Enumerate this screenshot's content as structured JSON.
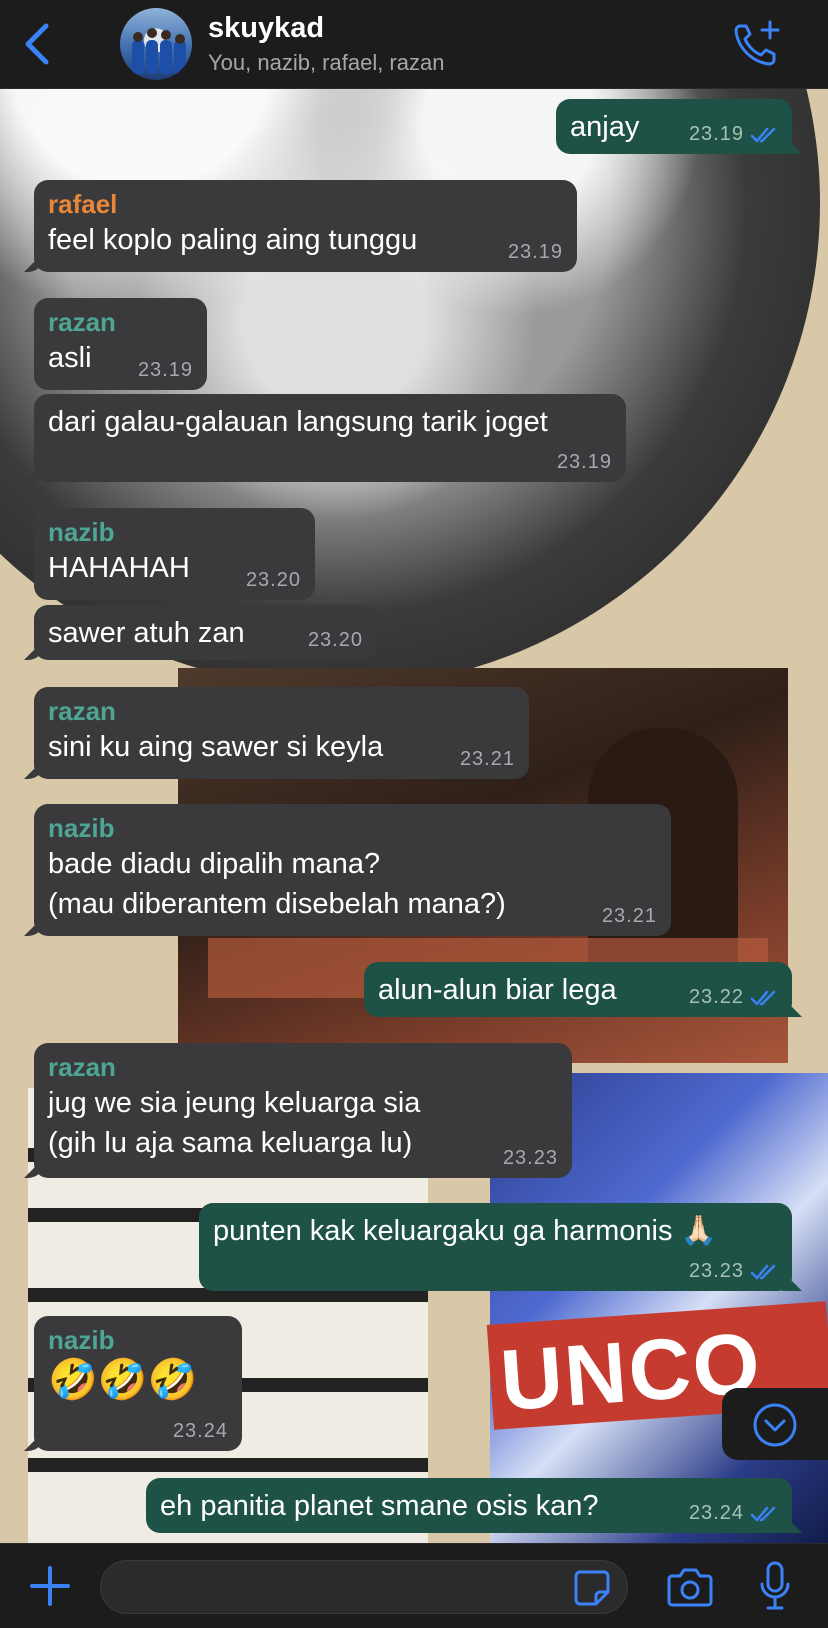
{
  "header": {
    "back_icon": "chevron-left-icon",
    "title": "skuykad",
    "subtitle": "You, nazib, rafael, razan",
    "call_icon": "add-call-icon"
  },
  "colors": {
    "accent": "#3b82f6",
    "incoming_bubble": "#3a3a3c",
    "outgoing_bubble": "#1f5246",
    "sender_rafael": "#e8873a",
    "sender_razan": "#4fa594",
    "sender_nazib": "#4fa594"
  },
  "messages": [
    {
      "dir": "out",
      "text": "anjay",
      "time": "23.19",
      "status": "read"
    },
    {
      "dir": "in",
      "sender": "rafael",
      "text": "feel koplo paling aing tunggu",
      "time": "23.19"
    },
    {
      "dir": "in",
      "sender": "razan",
      "text": "asli",
      "time": "23.19"
    },
    {
      "dir": "in",
      "text": "dari galau-galauan langsung tarik joget",
      "time": "23.19"
    },
    {
      "dir": "in",
      "sender": "nazib",
      "text": "HAHAHAH",
      "time": "23.20"
    },
    {
      "dir": "in",
      "text": "sawer atuh zan",
      "time": "23.20"
    },
    {
      "dir": "in",
      "sender": "razan",
      "text": "sini ku aing sawer si keyla",
      "time": "23.21"
    },
    {
      "dir": "in",
      "sender": "nazib",
      "text": "bade diadu dipalih mana?\n(mau diberantem disebelah mana?)",
      "time": "23.21"
    },
    {
      "dir": "out",
      "text": "alun-alun biar lega",
      "time": "23.22",
      "status": "read"
    },
    {
      "dir": "in",
      "sender": "razan",
      "text": "jug we sia jeung keluarga sia\n(gih lu aja sama keluarga lu)",
      "time": "23.23"
    },
    {
      "dir": "out",
      "text": "punten kak keluargaku ga harmonis 🙏🏻",
      "time": "23.23",
      "status": "read"
    },
    {
      "dir": "in",
      "sender": "nazib",
      "text": "🤣🤣🤣",
      "time": "23.24"
    },
    {
      "dir": "out",
      "text": "eh panitia planet smane osis kan?",
      "time": "23.24",
      "status": "read"
    }
  ],
  "scroll_button_icon": "chevron-down-circle-icon",
  "input_bar": {
    "attach_icon": "plus-icon",
    "sticker_icon": "sticker-icon",
    "camera_icon": "camera-icon",
    "mic_icon": "microphone-icon",
    "placeholder": ""
  }
}
